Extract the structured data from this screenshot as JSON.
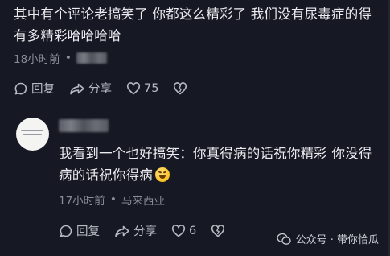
{
  "comment1": {
    "text": "其中有个评论老搞笑了 你都这么精彩了 我们没有尿毒症的得有多精彩哈哈哈哈",
    "time": "18小时前",
    "location_blurred": true,
    "actions": {
      "reply": "回复",
      "share": "分享",
      "likes": "75"
    }
  },
  "comment2": {
    "username_blurred": true,
    "text": "我看到一个也好搞笑：你真得病的话祝你精彩 你没得病的话祝你得病",
    "emoji": "rofl-emoji",
    "time": "17小时前",
    "location": "马来西亚",
    "actions": {
      "reply": "回复",
      "share": "分享",
      "likes": "6"
    }
  },
  "watermark": {
    "label": "公众号 · 带你恰瓜"
  },
  "colors": {
    "background": "#161823",
    "text": "#ececf0",
    "meta": "#8a8c96"
  }
}
